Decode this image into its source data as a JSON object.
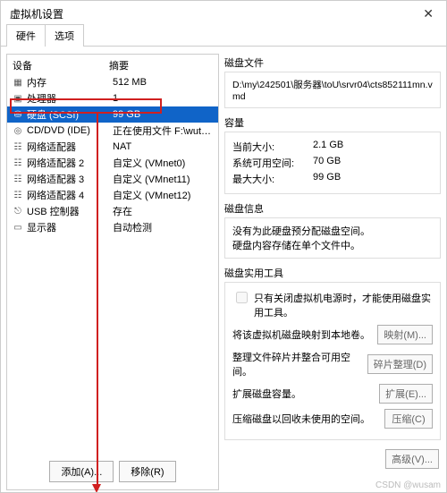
{
  "window": {
    "title": "虚拟机设置"
  },
  "tabs": {
    "hardware": "硬件",
    "options": "选项"
  },
  "hw_header": {
    "device": "设备",
    "summary": "摘要"
  },
  "hw": [
    {
      "icon": "memory-icon",
      "glyph": "▦",
      "name": "内存",
      "summary": "512 MB"
    },
    {
      "icon": "cpu-icon",
      "glyph": "▣",
      "name": "处理器",
      "summary": "1"
    },
    {
      "icon": "disk-icon",
      "glyph": "⛁",
      "name": "硬盘 (SCSI)",
      "summary": "99 GB"
    },
    {
      "icon": "cd-icon",
      "glyph": "◎",
      "name": "CD/DVD (IDE)",
      "summary": "正在使用文件 F:\\wutool\\Cent..."
    },
    {
      "icon": "nic-icon",
      "glyph": "☷",
      "name": "网络适配器",
      "summary": "NAT"
    },
    {
      "icon": "nic-icon",
      "glyph": "☷",
      "name": "网络适配器 2",
      "summary": "自定义 (VMnet0)"
    },
    {
      "icon": "nic-icon",
      "glyph": "☷",
      "name": "网络适配器 3",
      "summary": "自定义 (VMnet11)"
    },
    {
      "icon": "nic-icon",
      "glyph": "☷",
      "name": "网络适配器 4",
      "summary": "自定义 (VMnet12)"
    },
    {
      "icon": "usb-icon",
      "glyph": "⎋",
      "name": "USB 控制器",
      "summary": "存在"
    },
    {
      "icon": "display-icon",
      "glyph": "▭",
      "name": "显示器",
      "summary": "自动检测"
    }
  ],
  "buttons": {
    "add": "添加(A)...",
    "remove": "移除(R)",
    "advanced": "高级(V)..."
  },
  "disk_file": {
    "title": "磁盘文件",
    "path": "D:\\my\\242501\\服务器\\toU\\srvr04\\cts852111mn.vmd"
  },
  "capacity": {
    "title": "容量",
    "current_label": "当前大小:",
    "current_value": "2.1 GB",
    "free_label": "系统可用空间:",
    "free_value": "70 GB",
    "max_label": "最大大小:",
    "max_value": "99 GB"
  },
  "disk_info": {
    "title": "磁盘信息",
    "line1": "没有为此硬盘预分配磁盘空间。",
    "line2": "硬盘内容存储在单个文件中。"
  },
  "tools": {
    "title": "磁盘实用工具",
    "power_note": "只有关闭虚拟机电源时，才能使用磁盘实用工具。",
    "map_text": "将该虚拟机磁盘映射到本地卷。",
    "map_btn": "映射(M)...",
    "defrag_text": "整理文件碎片并整合可用空间。",
    "defrag_btn": "碎片整理(D)",
    "expand_text": "扩展磁盘容量。",
    "expand_btn": "扩展(E)...",
    "compact_text": "压缩磁盘以回收未使用的空间。",
    "compact_btn": "压缩(C)"
  },
  "watermark": "CSDN @wusam"
}
